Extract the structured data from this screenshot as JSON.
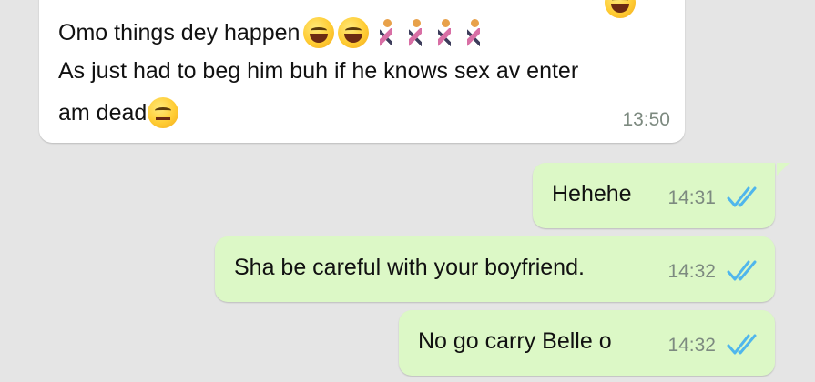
{
  "colors": {
    "background": "#e5e5e5",
    "incoming_bubble": "#ffffff",
    "outgoing_bubble": "#dcf8c6",
    "read_ticks": "#4fb6ec",
    "timestamp": "#7d8a80"
  },
  "messages": [
    {
      "direction": "incoming",
      "lines": [
        "Omo things dey happen",
        "As just had to beg him buh if he knows sex av enter",
        "am dead"
      ],
      "emoji": [
        "grinning-sweat-emoji",
        "tears-of-joy-emoji",
        "woman-running-emoji",
        "woman-running-emoji",
        "woman-running-emoji",
        "woman-running-emoji",
        "expressionless-emoji"
      ],
      "time": "13:50"
    },
    {
      "direction": "outgoing",
      "text": "Hehehe",
      "time": "14:31",
      "status_icon": "double-check-read-icon"
    },
    {
      "direction": "outgoing",
      "text": "Sha be careful with your boyfriend.",
      "time": "14:32",
      "status_icon": "double-check-read-icon"
    },
    {
      "direction": "outgoing",
      "text": "No go carry Belle o",
      "time": "14:32",
      "status_icon": "double-check-read-icon"
    }
  ]
}
